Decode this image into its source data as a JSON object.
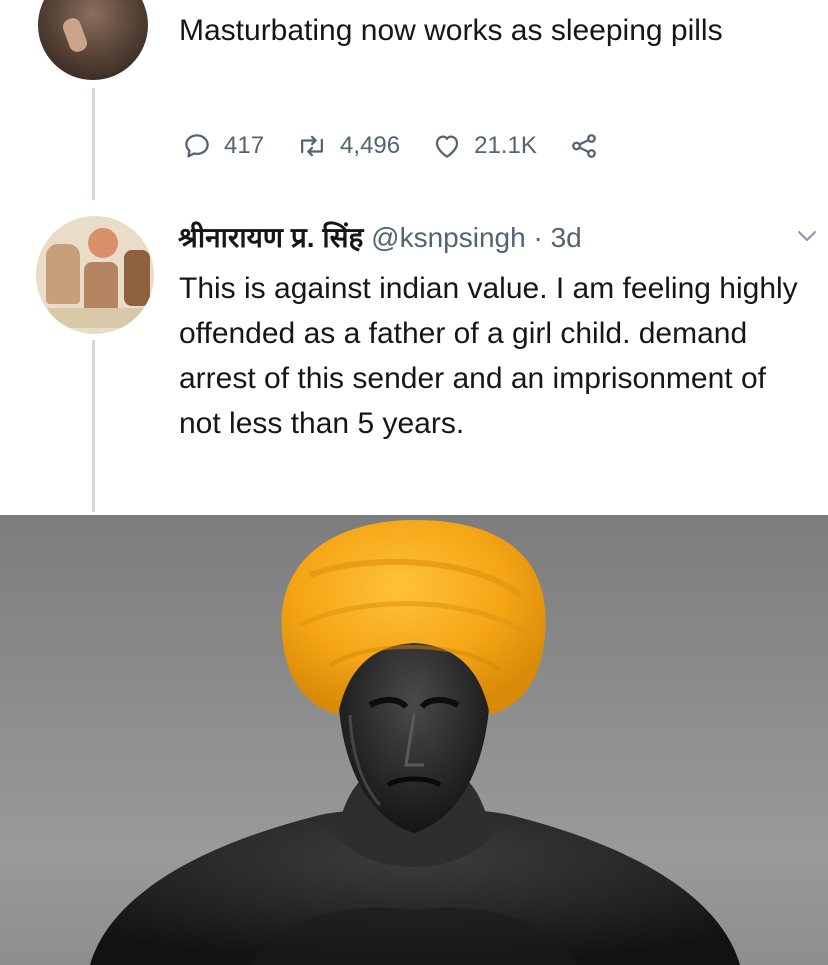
{
  "tweet": {
    "text": "Masturbating now works as sleeping pills",
    "actions": {
      "replies": "417",
      "retweets": "4,496",
      "likes": "21.1K"
    }
  },
  "reply": {
    "name": "श्रीनारायण प्र. सिंह",
    "handle": "@ksnpsingh",
    "separator": "·",
    "time": "3d",
    "text": "This is against indian value. I am feeling highly offended as a father of a girl child. demand arrest of this sender and an imprisonment of not less than 5 years."
  },
  "meme_image": {
    "subject": "grayscale muscular man wearing a saffron turban",
    "turban_color": "#f5a515"
  },
  "icons": [
    "reply-icon",
    "retweet-icon",
    "like-icon",
    "share-icon",
    "chevron-down-icon"
  ]
}
